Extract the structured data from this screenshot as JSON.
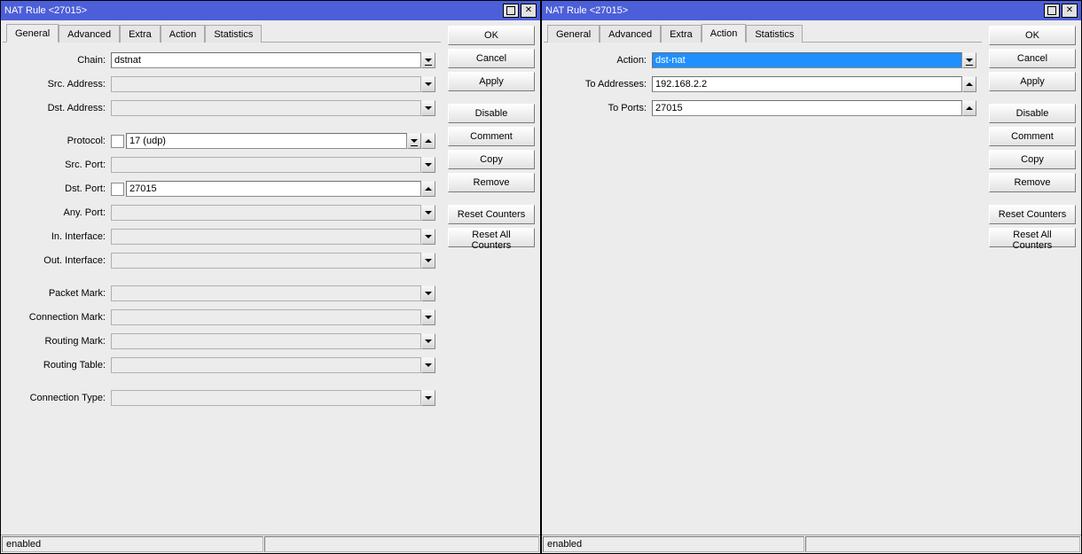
{
  "left": {
    "title": "NAT Rule <27015>",
    "tabs": [
      "General",
      "Advanced",
      "Extra",
      "Action",
      "Statistics"
    ],
    "active_tab": "General",
    "fields": {
      "chain_label": "Chain:",
      "chain_value": "dstnat",
      "src_addr_label": "Src. Address:",
      "dst_addr_label": "Dst. Address:",
      "protocol_label": "Protocol:",
      "protocol_value": "17 (udp)",
      "src_port_label": "Src. Port:",
      "dst_port_label": "Dst. Port:",
      "dst_port_value": "27015",
      "any_port_label": "Any. Port:",
      "in_if_label": "In. Interface:",
      "out_if_label": "Out. Interface:",
      "pkt_mark_label": "Packet Mark:",
      "con_mark_label": "Connection Mark:",
      "rt_mark_label": "Routing Mark:",
      "rt_table_label": "Routing Table:",
      "con_type_label": "Connection Type:"
    },
    "buttons": {
      "ok": "OK",
      "cancel": "Cancel",
      "apply": "Apply",
      "disable": "Disable",
      "comment": "Comment",
      "copy": "Copy",
      "remove": "Remove",
      "reset_counters": "Reset Counters",
      "reset_all_counters": "Reset All Counters"
    },
    "status": "enabled"
  },
  "right": {
    "title": "NAT Rule <27015>",
    "tabs": [
      "General",
      "Advanced",
      "Extra",
      "Action",
      "Statistics"
    ],
    "active_tab": "Action",
    "fields": {
      "action_label": "Action:",
      "action_value": "dst-nat",
      "to_addr_label": "To Addresses:",
      "to_addr_value": "192.168.2.2",
      "to_ports_label": "To Ports:",
      "to_ports_value": "27015"
    },
    "buttons": {
      "ok": "OK",
      "cancel": "Cancel",
      "apply": "Apply",
      "disable": "Disable",
      "comment": "Comment",
      "copy": "Copy",
      "remove": "Remove",
      "reset_counters": "Reset Counters",
      "reset_all_counters": "Reset All Counters"
    },
    "status": "enabled"
  }
}
